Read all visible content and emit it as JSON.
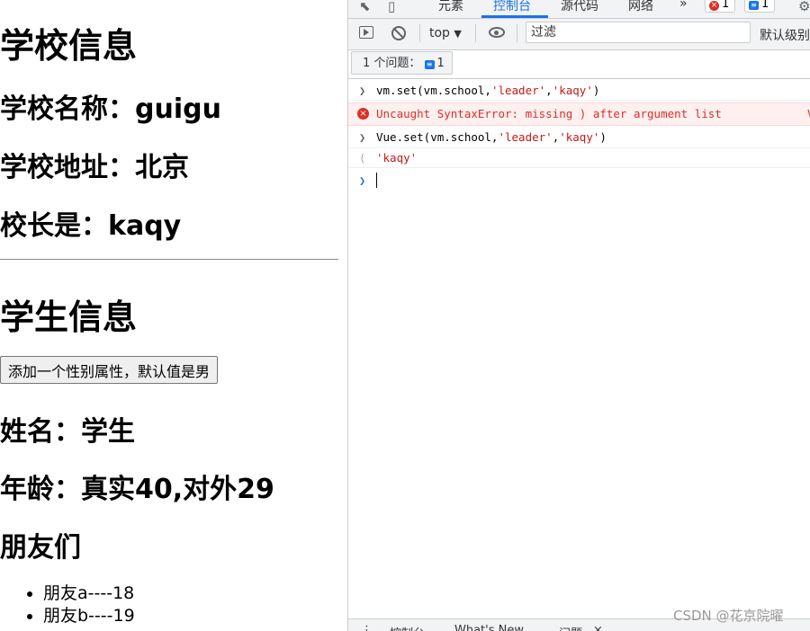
{
  "page": {
    "school_heading": "学校信息",
    "school_name": "学校名称：guigu",
    "school_address": "学校地址：北京",
    "school_leader": "校长是：kaqy",
    "student_heading": "学生信息",
    "add_sex_button": "添加一个性别属性，默认值是男",
    "student_name": "姓名：学生",
    "student_age": "年龄：真实40,对外29",
    "friends_heading": "朋友们",
    "friends": [
      "朋友a----18",
      "朋友b----19"
    ]
  },
  "devtools": {
    "tabs": {
      "elements": "元素",
      "console": "控制台",
      "sources": "源代码",
      "network": "网络",
      "more": "»"
    },
    "error_count": "1",
    "message_count": "1",
    "toolbar": {
      "context": "top",
      "filter_placeholder": "过滤",
      "levels": "默认级别"
    },
    "issues": {
      "label": "1 个问题：",
      "count": "1"
    },
    "console_lines": {
      "l1_pre": "vm.set(vm.school,",
      "l1_s1": "'leader'",
      "l1_c": ",",
      "l1_s2": "'kaqy'",
      "l1_post": ")",
      "error": "Uncaught SyntaxError: missing ) after argument list",
      "error_source": "V",
      "l3_pre": "Vue.set(vm.school,",
      "l3_s1": "'leader'",
      "l3_c": ",",
      "l3_s2": "'kaqy'",
      "l3_post": ")",
      "result": "'kaqy'"
    },
    "drawer": {
      "console": "控制台",
      "whats_new": "What's New",
      "issues": "问题",
      "close": "×"
    },
    "icons": [
      "inspect-icon",
      "device-toolbar-icon",
      "sidebar-toggle-icon",
      "clear-console-icon",
      "eye-icon",
      "settings-icon"
    ],
    "colors": {
      "accent": "#1a73e8",
      "error": "#d93025",
      "string": "#881280"
    }
  },
  "watermark": "CSDN @花京院曜"
}
